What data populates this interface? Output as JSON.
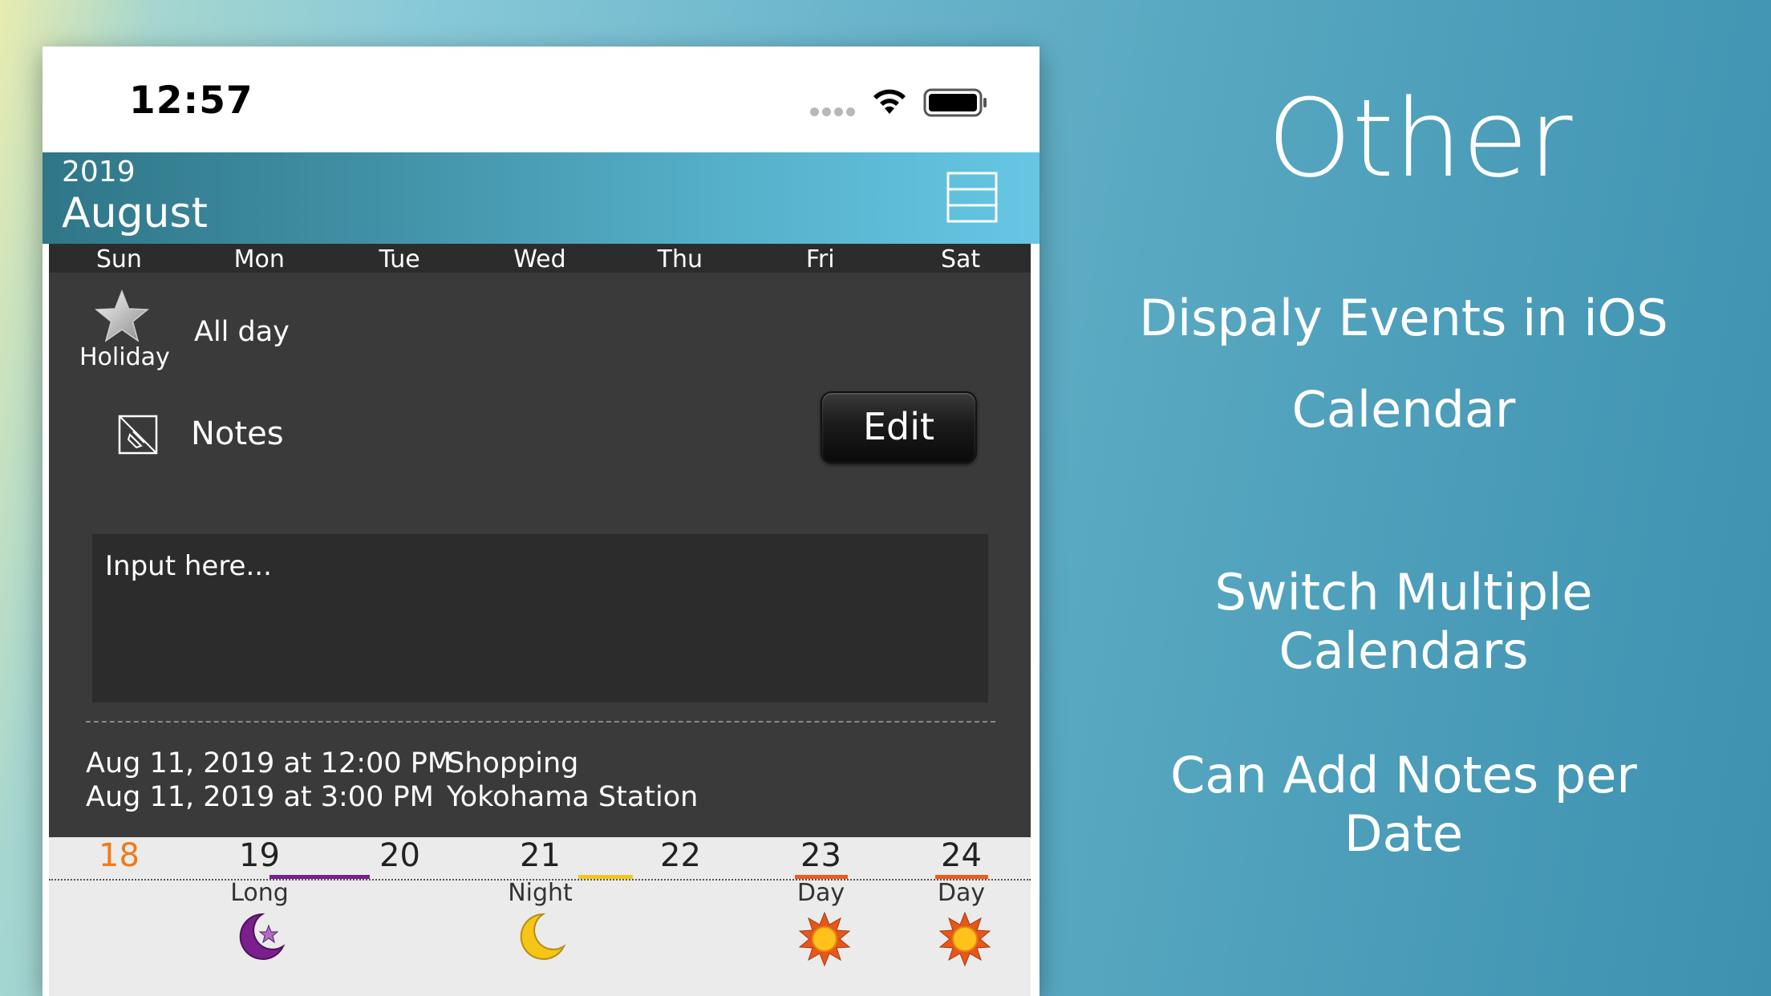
{
  "status_bar": {
    "time": "12:57"
  },
  "header": {
    "year": "2019",
    "month": "August"
  },
  "weekdays": [
    "Sun",
    "Mon",
    "Tue",
    "Wed",
    "Thu",
    "Fri",
    "Sat"
  ],
  "holiday_label": "Holiday",
  "allday_label": "All day",
  "notes": {
    "label": "Notes",
    "edit_label": "Edit",
    "placeholder": "Input here..."
  },
  "event": {
    "start": "Aug 11, 2019 at 12:00 PM",
    "end": "Aug 11, 2019 at 3:00 PM",
    "title": "Shopping",
    "location": "Yokohama Station"
  },
  "week": [
    {
      "day": "18",
      "shift": "",
      "icon": "",
      "color": "#f07a1a"
    },
    {
      "day": "19",
      "shift": "Long",
      "icon": "moon-star-icon",
      "color": "#7b1f8e"
    },
    {
      "day": "20",
      "shift": "",
      "icon": ""
    },
    {
      "day": "21",
      "shift": "Night",
      "icon": "moon-icon",
      "color": "#f5c518"
    },
    {
      "day": "22",
      "shift": "",
      "icon": ""
    },
    {
      "day": "23",
      "shift": "Day",
      "icon": "sun-icon",
      "color": "#f05a1a"
    },
    {
      "day": "24",
      "shift": "Day",
      "icon": "sun-icon",
      "color": "#f05a1a"
    }
  ],
  "promo": {
    "title": "Other",
    "line1a": "Dispaly Events in iOS",
    "line1b": "Calendar",
    "line2": "Switch Multiple Calendars",
    "line3": "Can Add Notes per Date"
  }
}
